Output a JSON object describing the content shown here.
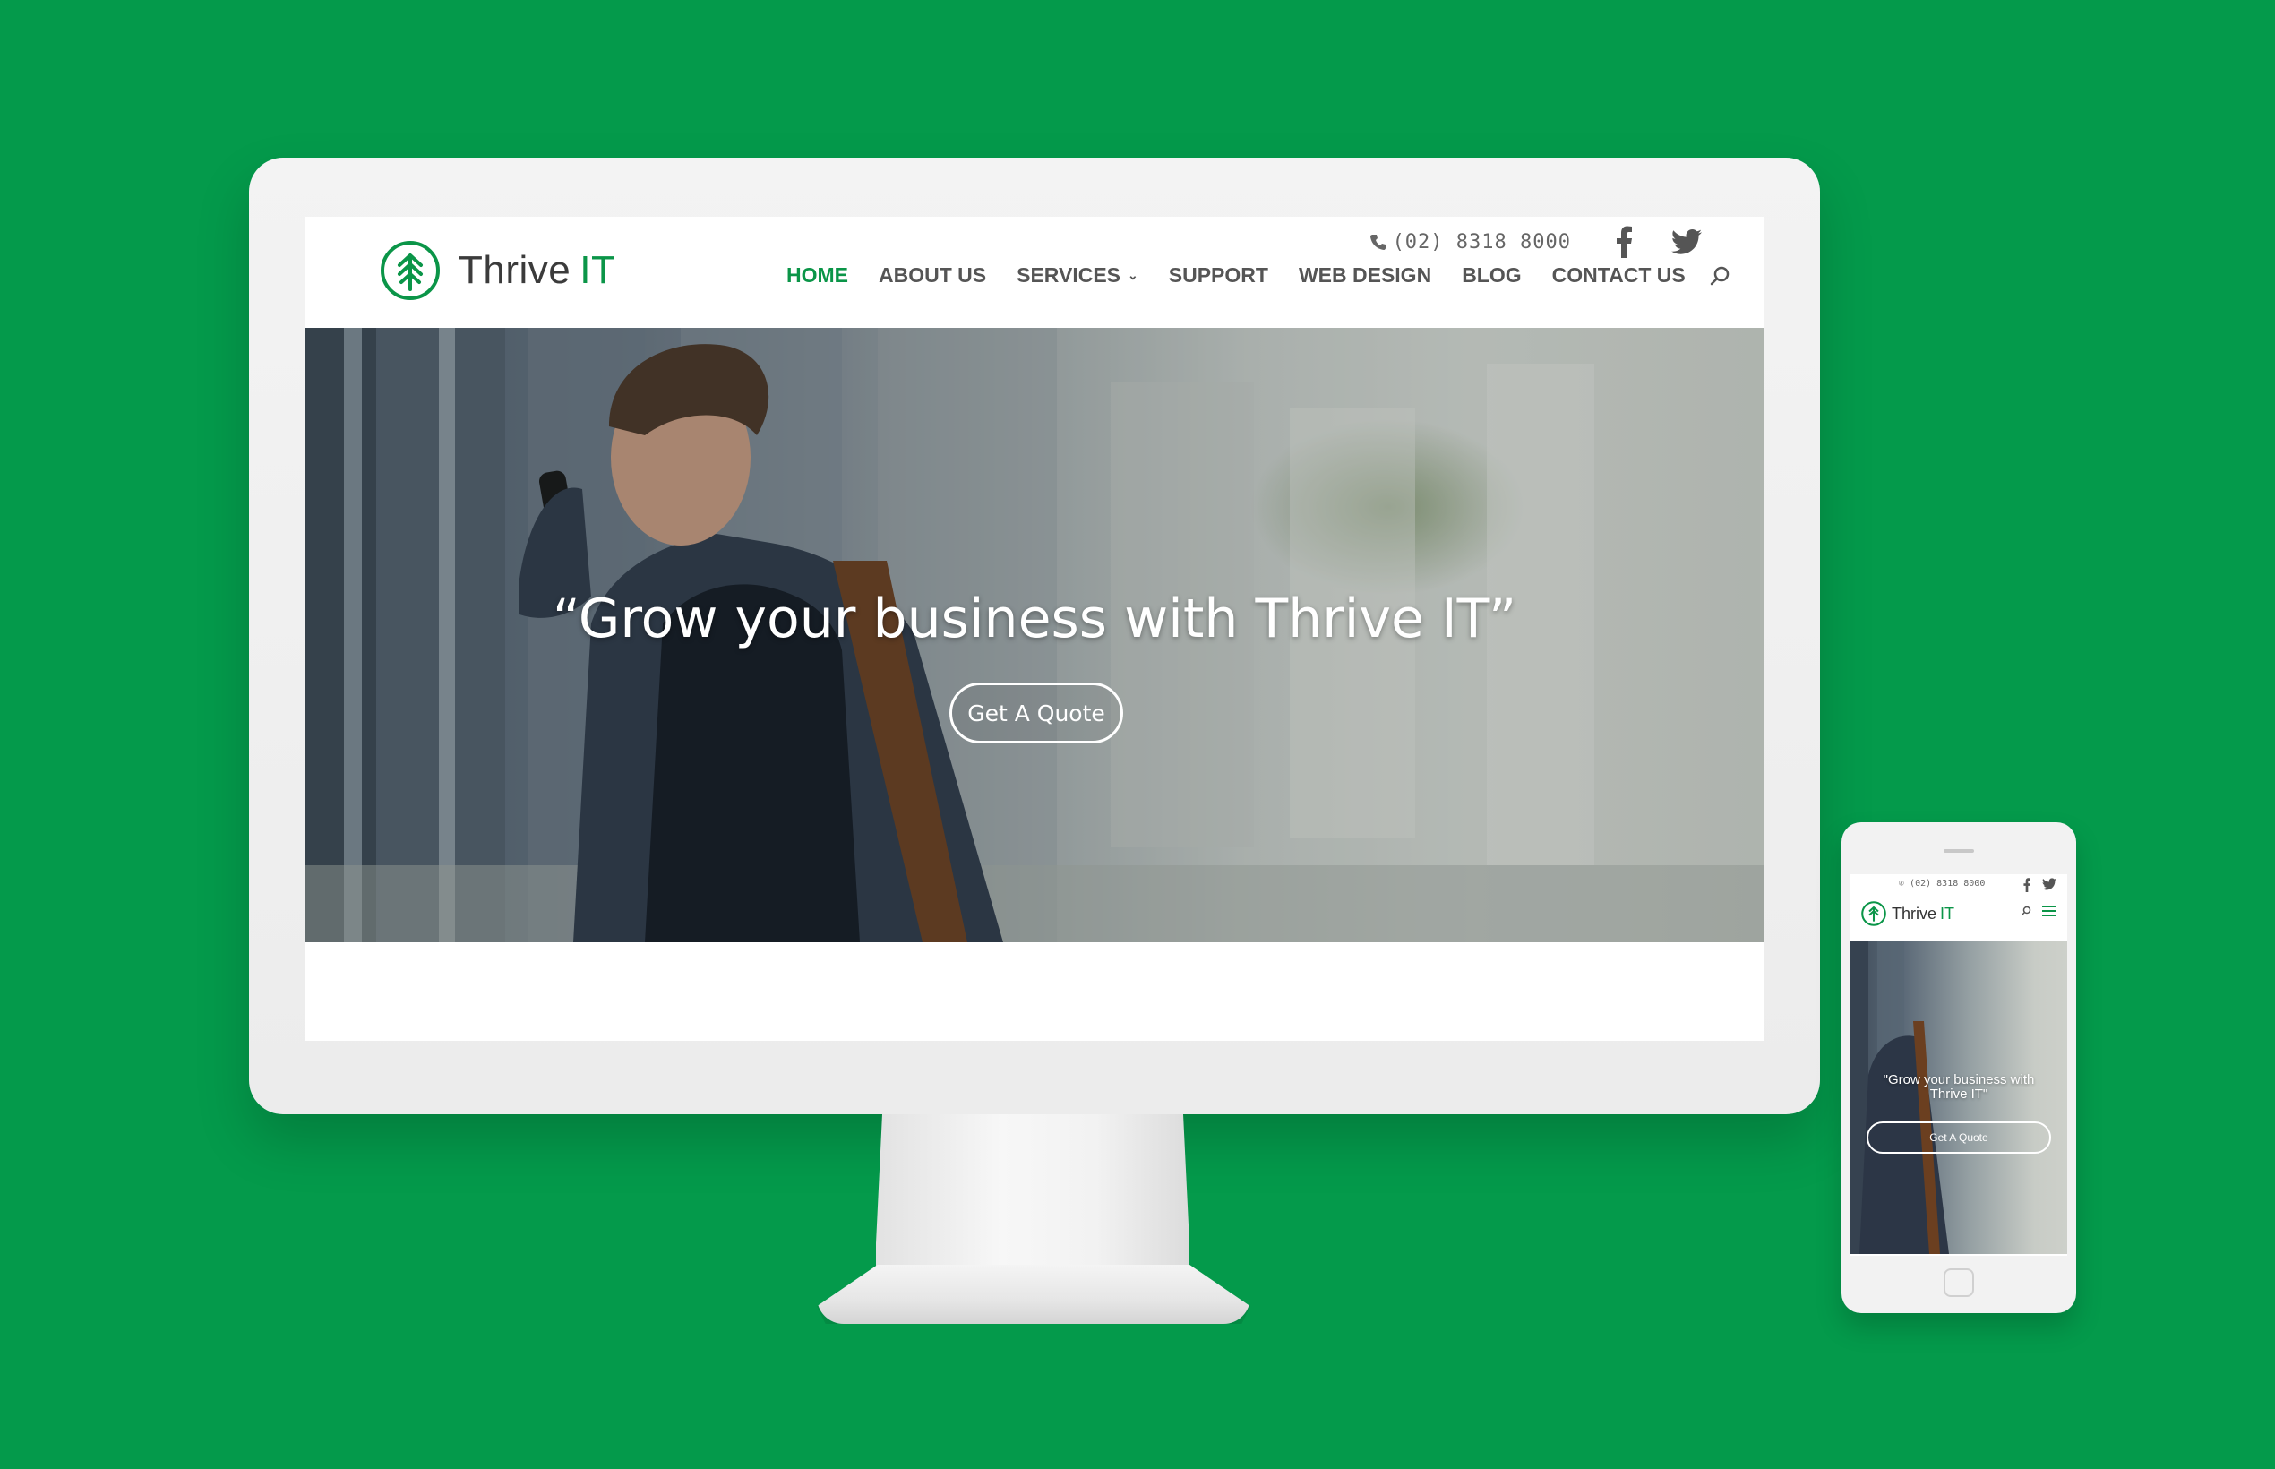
{
  "colors": {
    "background": "#049a4b",
    "brand_green": "#0b9548",
    "nav_text": "#555555"
  },
  "site": {
    "logo": {
      "name": "Thrive",
      "suffix": "IT",
      "icon": "tree-arrow-logo-icon"
    },
    "phone": "(02) 8318 8000",
    "social": [
      "facebook-icon",
      "twitter-icon"
    ],
    "nav": [
      {
        "label": "HOME",
        "active": true
      },
      {
        "label": "ABOUT US"
      },
      {
        "label": "SERVICES",
        "dropdown": true
      },
      {
        "label": "SUPPORT"
      },
      {
        "label": "WEB DESIGN"
      },
      {
        "label": "BLOG"
      },
      {
        "label": "CONTACT US"
      }
    ],
    "hero": {
      "title": "“Grow your business with Thrive IT”",
      "button": "Get A Quote"
    }
  },
  "mobile": {
    "phone": "(02) 8318 8000",
    "logo": {
      "name": "Thrive",
      "suffix": "IT"
    },
    "hero": {
      "title_line1": "\"Grow your business with",
      "title_line2": "Thrive IT\"",
      "button": "Get A Quote"
    }
  }
}
